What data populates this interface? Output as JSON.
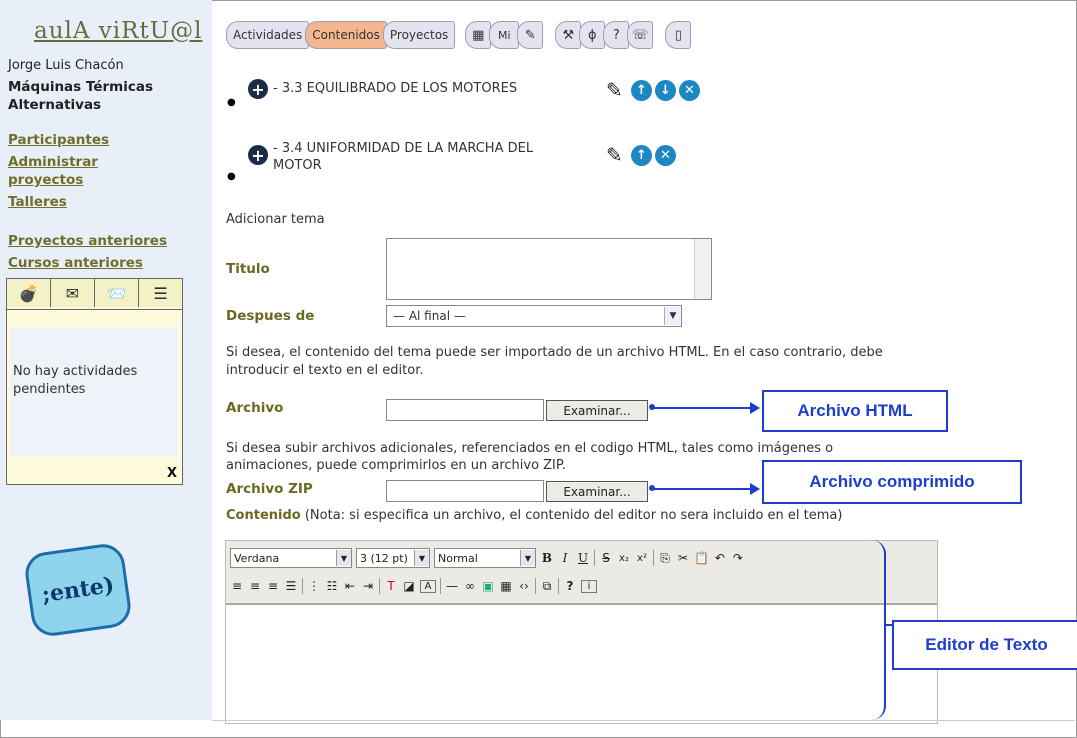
{
  "sidebar": {
    "logo": "aulA viRtU@l",
    "user": "Jorge Luis Chacón",
    "course": "Máquinas Térmicas Alternativas",
    "links": [
      "Participantes",
      "Administrar proyectos",
      "Talleres",
      "Proyectos anteriores",
      "Cursos anteriores"
    ],
    "panel_tabs": [
      "bomb-icon",
      "mail-icon",
      "alert-mail-icon",
      "list-mail-icon"
    ],
    "panel_text": "No hay actividades pendientes",
    "panel_close": "X",
    "gente_logo": ";ente)"
  },
  "toolbar": {
    "tabs": [
      "Actividades",
      "Contenidos",
      "Proyectos"
    ],
    "active_tab": "Contenidos",
    "mi_label": "Mi"
  },
  "topics": [
    {
      "label": "- 3.3 EQUILIBRADO DE LOS MOTORES"
    },
    {
      "label": "- 3.4 UNIFORMIDAD DE LA MARCHA DEL MOTOR"
    }
  ],
  "form": {
    "heading": "Adicionar tema",
    "titulo_label": "Titulo",
    "despues_label": "Despues de",
    "despues_value": "— Al final —",
    "html_note": "Si desea, el contenido del tema puede ser importado de un archivo HTML. En el caso contrario, debe introducir el texto en el editor.",
    "archivo_label": "Archivo",
    "examinar": "Examinar...",
    "zip_note": "Si desea subir archivos adicionales, referenciados en el codigo HTML, tales como imágenes o animaciones, puede comprimirlos en un archivo ZIP.",
    "zip_label": "Archivo ZIP",
    "contenido_label": "Contenido",
    "contenido_note": "(Nota: si especifica un archivo, el contenido del editor no sera incluido en el tema)"
  },
  "editor": {
    "font": "Verdana",
    "size": "3 (12 pt)",
    "style": "Normal"
  },
  "callouts": {
    "html": "Archivo HTML",
    "zip": "Archivo comprimido",
    "editor": "Editor de Texto"
  },
  "colors": {
    "link": "#6f6f2a",
    "callout": "#1d3dcc",
    "active_tab": "#f3b68e",
    "action_icon": "#1d87c4"
  }
}
